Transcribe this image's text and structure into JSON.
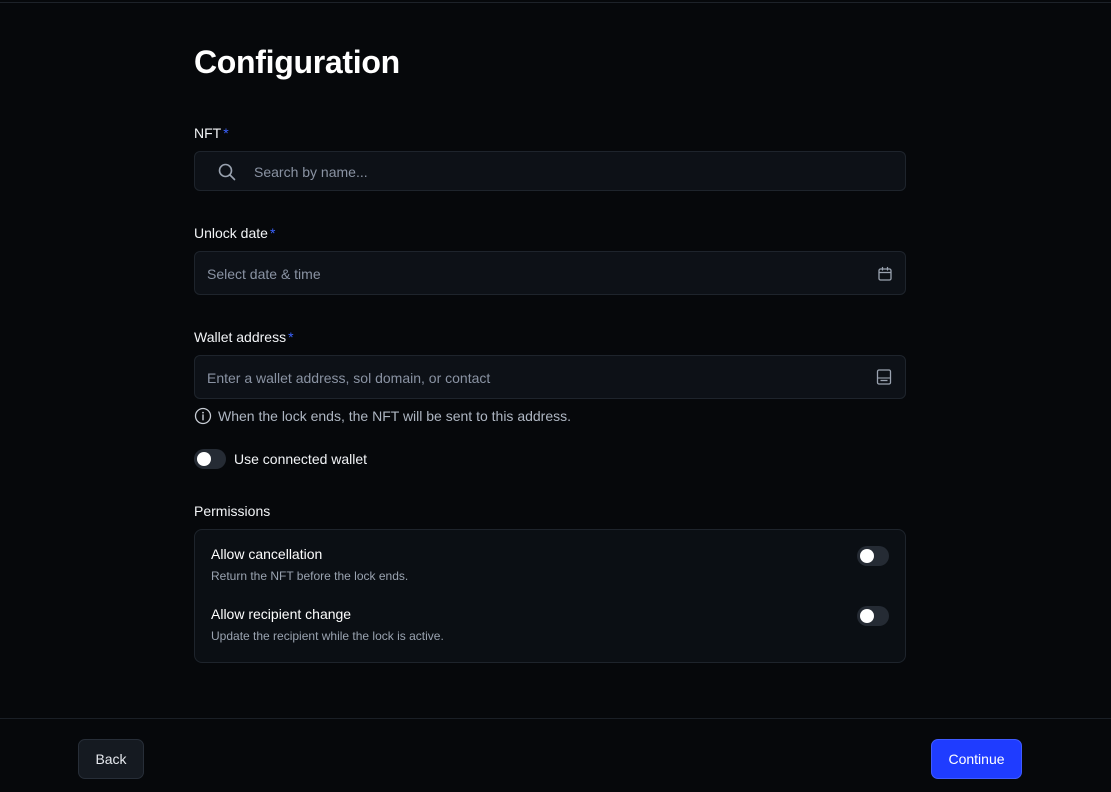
{
  "page": {
    "title": "Configuration"
  },
  "nft": {
    "label": "NFT",
    "required_mark": "*",
    "placeholder": "Search by name...",
    "icon": "search-icon"
  },
  "unlock_date": {
    "label": "Unlock date",
    "required_mark": "*",
    "placeholder": "Select date & time",
    "icon": "calendar-icon"
  },
  "wallet": {
    "label": "Wallet address",
    "required_mark": "*",
    "placeholder": "Enter a wallet address, sol domain, or contact",
    "icon": "address-book-icon",
    "hint": "When the lock ends, the NFT will be sent to this address.",
    "hint_icon": "info-icon"
  },
  "use_connected_wallet": {
    "label": "Use connected wallet",
    "enabled": false
  },
  "permissions": {
    "heading": "Permissions",
    "items": [
      {
        "title": "Allow cancellation",
        "description": "Return the NFT before the lock ends.",
        "enabled": false
      },
      {
        "title": "Allow recipient change",
        "description": "Update the recipient while the lock is active.",
        "enabled": false
      }
    ]
  },
  "footer": {
    "back_label": "Back",
    "continue_label": "Continue"
  },
  "colors": {
    "background": "#06080b",
    "accent": "#1f3cff",
    "required": "#3b63ff"
  }
}
